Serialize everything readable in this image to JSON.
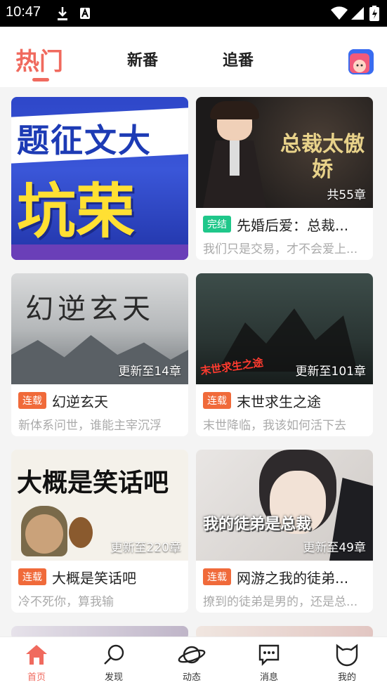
{
  "status_bar": {
    "time": "10:47"
  },
  "top_tabs": [
    {
      "label": "热门"
    },
    {
      "label": "新番"
    },
    {
      "label": "追番"
    }
  ],
  "accent_color": "#f06a5e",
  "banner": {
    "line1": "题征文大",
    "line2": "坑荣"
  },
  "cards": [
    {
      "cover_title": "总裁太傲娇",
      "cover_caption": "共55章",
      "badge": "完结",
      "title": "先婚后爱：总裁...",
      "desc": "我们只是交易，才不会爱上..."
    },
    {
      "cover_title": "幻逆玄天",
      "cover_caption": "更新至14章",
      "badge": "连载",
      "title": "幻逆玄天",
      "desc": "新体系问世，谁能主宰沉浮"
    },
    {
      "cover_title": "末世求生之途",
      "cover_caption": "更新至101章",
      "badge": "连载",
      "title": "末世求生之途",
      "desc": "末世降临，我该如何活下去"
    },
    {
      "cover_title": "大概是笑话吧",
      "cover_caption": "更新至220章",
      "badge": "连载",
      "title": "大概是笑话吧",
      "desc": "冷不死你，算我输"
    },
    {
      "cover_title": "我的徒弟是总裁",
      "cover_caption": "更新至49章",
      "badge": "连载",
      "title": "网游之我的徒弟...",
      "desc": "撩到的徒弟是男的，还是总..."
    }
  ],
  "bottom_nav": [
    {
      "label": "首页",
      "icon": "home-icon"
    },
    {
      "label": "发现",
      "icon": "search-icon"
    },
    {
      "label": "动态",
      "icon": "planet-icon"
    },
    {
      "label": "消息",
      "icon": "message-icon"
    },
    {
      "label": "我的",
      "icon": "profile-icon"
    }
  ]
}
